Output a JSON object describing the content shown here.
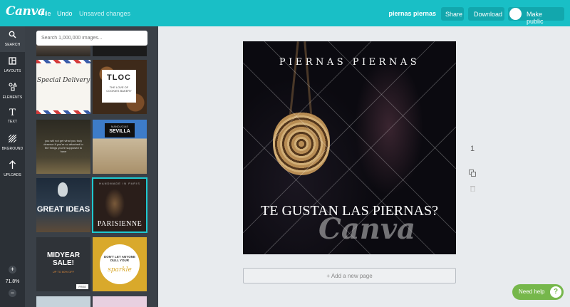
{
  "app": {
    "logo": "Canva"
  },
  "menu": {
    "file": "File",
    "undo": "Undo",
    "status": "Unsaved changes"
  },
  "document": {
    "title": "piernas piernas"
  },
  "toolbar": {
    "share": "Share",
    "download": "Download",
    "make_public": "Make public"
  },
  "sidebar": {
    "items": [
      {
        "label": "SEARCH",
        "icon": "search-icon"
      },
      {
        "label": "LAYOUTS",
        "icon": "layouts-icon"
      },
      {
        "label": "ELEMENTS",
        "icon": "elements-icon"
      },
      {
        "label": "TEXT",
        "icon": "text-icon"
      },
      {
        "label": "BKGROUND",
        "icon": "background-icon"
      },
      {
        "label": "UPLOADS",
        "icon": "uploads-icon"
      }
    ],
    "zoom_in": "+",
    "zoom_level": "71.8%",
    "zoom_out": "−"
  },
  "panel": {
    "search_placeholder": "Search 1,000,000 images...",
    "thumbs": {
      "special_delivery": "Special Delivery",
      "tloc": "TLOC",
      "tloc_sub": "THE LOVE OF COOKIES BAKERY",
      "quote": "you will not get what you truly deserve if you're so attached to the things you're supposed to have",
      "sevilla": "SEVILLA",
      "sevilla_top": "MANDUCIAS",
      "great_ideas": "GREAT IDEAS",
      "parisienne_top": "HANDMADE IN PARIS",
      "parisienne": "PARISIENNE",
      "midyear": "MIDYEAR SALE!",
      "midyear_sub": "UP TO 60% OFF",
      "midyear_badge": "FREE",
      "sparkle_top": "DON'T LET ANYONE DULL YOUR",
      "sparkle": "sparkle"
    }
  },
  "design": {
    "title": "PIERNAS PIERNAS",
    "caption": "TE GUSTAN LAS PIERNAS?",
    "watermark": "Canva"
  },
  "page_number": "1",
  "add_page": "+ Add a new page",
  "help": {
    "label": "Need help",
    "icon": "?"
  }
}
